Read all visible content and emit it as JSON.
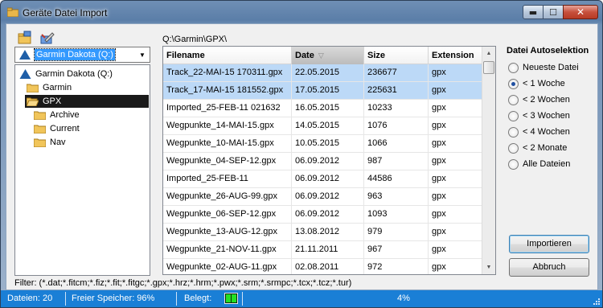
{
  "window": {
    "title": "Geräte Datei Import",
    "minimize_glyph": "▬",
    "maximize_glyph": "☐",
    "close_glyph": "✕"
  },
  "toolbar": {
    "icons": [
      "open-folder-icon",
      "edit-device-icon"
    ]
  },
  "drive_combo": {
    "value": "Garmin Dakota (Q:)",
    "icon": "garmin-triangle-icon",
    "arrow": "▼"
  },
  "tree": {
    "items": [
      {
        "label": "Garmin Dakota (Q:)",
        "icon": "garmin-triangle-icon",
        "level": 0,
        "selected": false
      },
      {
        "label": "Garmin",
        "icon": "folder-icon",
        "level": 1,
        "selected": false
      },
      {
        "label": "GPX",
        "icon": "folder-open-icon",
        "level": 1,
        "selected": true
      },
      {
        "label": "Archive",
        "icon": "folder-icon",
        "level": 2,
        "selected": false
      },
      {
        "label": "Current",
        "icon": "folder-icon",
        "level": 2,
        "selected": false
      },
      {
        "label": "Nav",
        "icon": "folder-icon",
        "level": 2,
        "selected": false
      }
    ]
  },
  "path": "Q:\\Garmin\\GPX\\",
  "file_table": {
    "columns": [
      {
        "label": "Filename"
      },
      {
        "label": "Date",
        "sort_glyph": "▽",
        "sorted": true
      },
      {
        "label": "Size"
      },
      {
        "label": "Extension"
      }
    ],
    "rows": [
      {
        "filename": "Track_22-MAI-15 170311.gpx",
        "date": "22.05.2015",
        "size": "236677",
        "ext": "gpx",
        "selected": true
      },
      {
        "filename": "Track_17-MAI-15 181552.gpx",
        "date": "17.05.2015",
        "size": "225631",
        "ext": "gpx",
        "selected": true
      },
      {
        "filename": "Imported_25-FEB-11 021632",
        "date": "16.05.2015",
        "size": "10233",
        "ext": "gpx",
        "selected": false
      },
      {
        "filename": "Wegpunkte_14-MAI-15.gpx",
        "date": "14.05.2015",
        "size": "1076",
        "ext": "gpx",
        "selected": false
      },
      {
        "filename": "Wegpunkte_10-MAI-15.gpx",
        "date": "10.05.2015",
        "size": "1066",
        "ext": "gpx",
        "selected": false
      },
      {
        "filename": "Wegpunkte_04-SEP-12.gpx",
        "date": "06.09.2012",
        "size": "987",
        "ext": "gpx",
        "selected": false
      },
      {
        "filename": "Imported_25-FEB-11",
        "date": "06.09.2012",
        "size": "44586",
        "ext": "gpx",
        "selected": false
      },
      {
        "filename": "Wegpunkte_26-AUG-99.gpx",
        "date": "06.09.2012",
        "size": "963",
        "ext": "gpx",
        "selected": false
      },
      {
        "filename": "Wegpunkte_06-SEP-12.gpx",
        "date": "06.09.2012",
        "size": "1093",
        "ext": "gpx",
        "selected": false
      },
      {
        "filename": "Wegpunkte_13-AUG-12.gpx",
        "date": "13.08.2012",
        "size": "979",
        "ext": "gpx",
        "selected": false
      },
      {
        "filename": "Wegpunkte_21-NOV-11.gpx",
        "date": "21.11.2011",
        "size": "967",
        "ext": "gpx",
        "selected": false
      },
      {
        "filename": "Wegpunkte_02-AUG-11.gpx",
        "date": "02.08.2011",
        "size": "972",
        "ext": "gpx",
        "selected": false
      }
    ],
    "scroll_up": "▲",
    "scroll_down": "▼"
  },
  "auto_select": {
    "title": "Datei Autoselektion",
    "options": [
      {
        "label": "Neueste Datei",
        "checked": false
      },
      {
        "label": "< 1 Woche",
        "checked": true
      },
      {
        "label": "< 2 Wochen",
        "checked": false
      },
      {
        "label": "< 3 Wochen",
        "checked": false
      },
      {
        "label": "< 4 Wochen",
        "checked": false
      },
      {
        "label": "< 2 Monate",
        "checked": false
      },
      {
        "label": "Alle Dateien",
        "checked": false
      }
    ]
  },
  "buttons": {
    "import_label": "Importieren",
    "cancel_label": "Abbruch"
  },
  "filter_text": "Filter: (*.dat;*.fitcm;*.fiz;*.fit;*.fitgc;*.gpx;*.hrz;*.hrm;*.pwx;*.srm;*.srmpc;*.tcx;*.tcz;*.tur)",
  "status": {
    "files": "Dateien: 20",
    "free_memory": "Freier Speicher: 96%",
    "used_label": "Belegt:",
    "used_fraction": 0.04,
    "used_percent": "4%"
  },
  "colors": {
    "status_bar": "#1a7fd6",
    "row_selected": "#bcd9f7",
    "tree_selected": "#1a1a1a",
    "meter_fill": "#24e024"
  }
}
